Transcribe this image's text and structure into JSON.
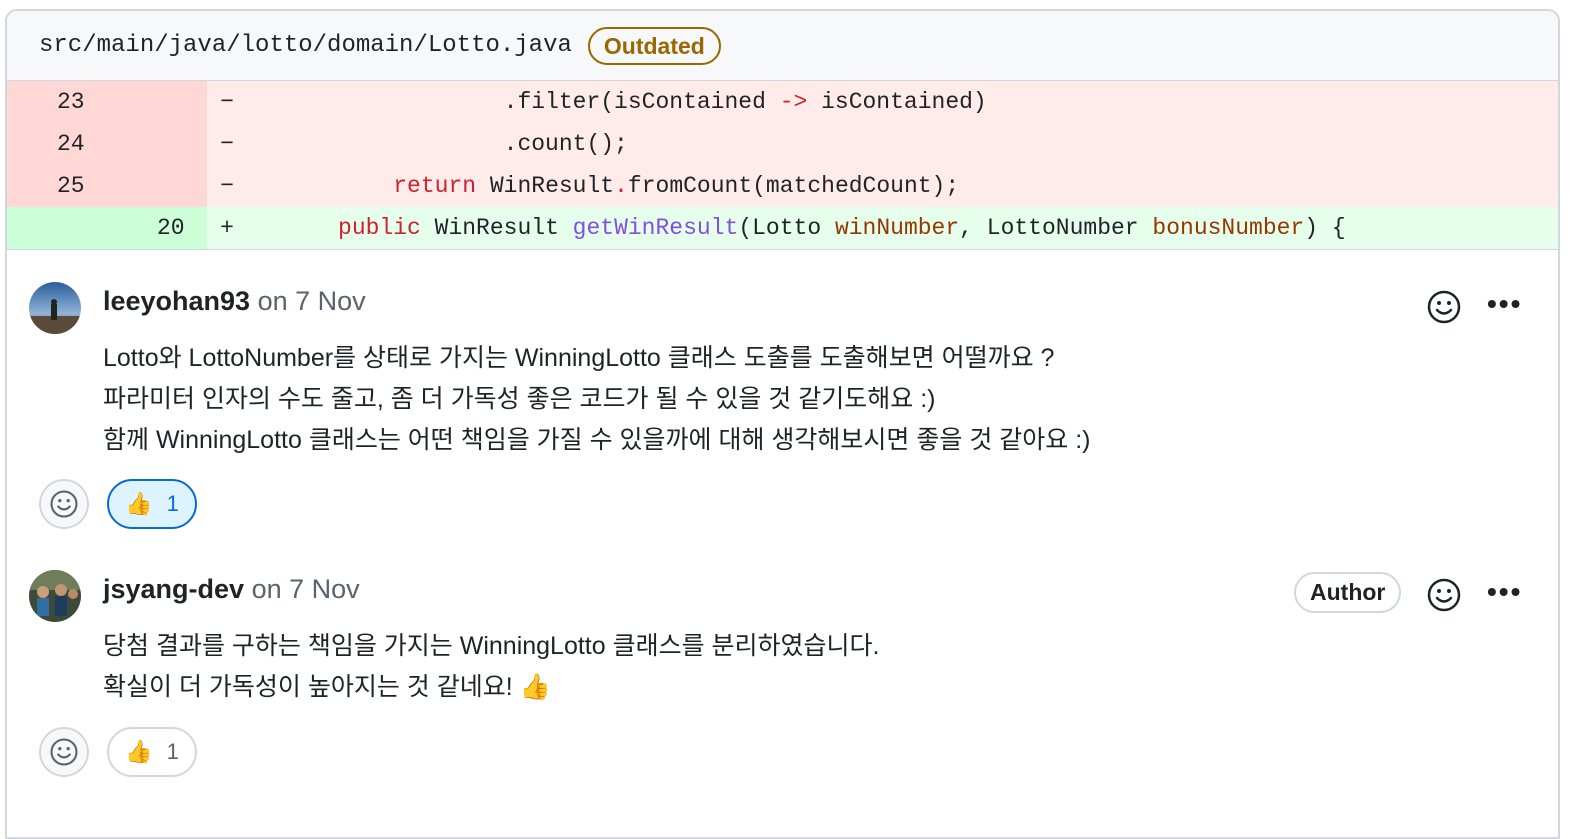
{
  "file": {
    "path": "src/main/java/lotto/domain/Lotto.java",
    "badge": "Outdated"
  },
  "diff": {
    "lines": [
      {
        "num": "23",
        "marker": "−",
        "indent": "                 ",
        "tokens": [
          [
            ".filter(isContained ",
            ""
          ],
          [
            "->",
            "kw"
          ],
          [
            " isContained)",
            ""
          ]
        ]
      },
      {
        "num": "24",
        "marker": "−",
        "indent": "                 ",
        "tokens": [
          [
            ".count();",
            ""
          ]
        ]
      },
      {
        "num": "25",
        "marker": "−",
        "indent": "         ",
        "tokens": [
          [
            "return",
            "kw"
          ],
          [
            " WinResult",
            ""
          ],
          [
            ".",
            "kw"
          ],
          [
            "fromCount(matchedCount);",
            ""
          ]
        ]
      },
      {
        "num": "20",
        "marker": "+",
        "indent": "     ",
        "tokens": [
          [
            "public",
            "kw"
          ],
          [
            " WinResult ",
            ""
          ],
          [
            "getWinResult",
            "fn"
          ],
          [
            "(Lotto ",
            ""
          ],
          [
            "winNumber",
            "param"
          ],
          [
            ", LottoNumber ",
            ""
          ],
          [
            "bonusNumber",
            "param"
          ],
          [
            ") {",
            ""
          ]
        ]
      }
    ]
  },
  "comments": [
    {
      "author": "leeyohan93",
      "date": "on 7 Nov",
      "lines": [
        "Lotto와 LottoNumber를 상태로 가지는 WinningLotto 클래스 도출를 도출해보면 어떨까요 ?",
        "파라미터 인자의 수도 줄고, 좀 더 가독성 좋은 코드가 될 수 있을 것 같기도해요 :)",
        "함께 WinningLotto 클래스는 어떤 책임을 가질 수 있을까에 대해 생각해보시면 좋을 것 같아요 :)"
      ],
      "reaction": {
        "emoji": "👍",
        "count": "1"
      }
    },
    {
      "author": "jsyang-dev",
      "date": "on 7 Nov",
      "badge": "Author",
      "lines": [
        "당첨 결과를 구하는 책임을 가지는 WinningLotto 클래스를 분리하였습니다.",
        "확실이 더 가독성이 높아지는 것 같네요! 👍"
      ],
      "reaction": {
        "emoji": "👍",
        "count": "1"
      }
    }
  ],
  "icons": {
    "more": "•••",
    "emoji": "smiley-icon"
  }
}
